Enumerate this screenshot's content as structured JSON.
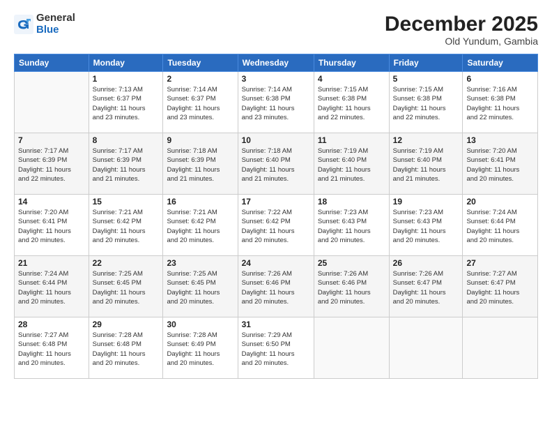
{
  "logo": {
    "general": "General",
    "blue": "Blue"
  },
  "title": "December 2025",
  "subtitle": "Old Yundum, Gambia",
  "days_header": [
    "Sunday",
    "Monday",
    "Tuesday",
    "Wednesday",
    "Thursday",
    "Friday",
    "Saturday"
  ],
  "weeks": [
    [
      {
        "day": "",
        "info": ""
      },
      {
        "day": "1",
        "info": "Sunrise: 7:13 AM\nSunset: 6:37 PM\nDaylight: 11 hours\nand 23 minutes."
      },
      {
        "day": "2",
        "info": "Sunrise: 7:14 AM\nSunset: 6:37 PM\nDaylight: 11 hours\nand 23 minutes."
      },
      {
        "day": "3",
        "info": "Sunrise: 7:14 AM\nSunset: 6:38 PM\nDaylight: 11 hours\nand 23 minutes."
      },
      {
        "day": "4",
        "info": "Sunrise: 7:15 AM\nSunset: 6:38 PM\nDaylight: 11 hours\nand 22 minutes."
      },
      {
        "day": "5",
        "info": "Sunrise: 7:15 AM\nSunset: 6:38 PM\nDaylight: 11 hours\nand 22 minutes."
      },
      {
        "day": "6",
        "info": "Sunrise: 7:16 AM\nSunset: 6:38 PM\nDaylight: 11 hours\nand 22 minutes."
      }
    ],
    [
      {
        "day": "7",
        "info": "Sunrise: 7:17 AM\nSunset: 6:39 PM\nDaylight: 11 hours\nand 22 minutes."
      },
      {
        "day": "8",
        "info": "Sunrise: 7:17 AM\nSunset: 6:39 PM\nDaylight: 11 hours\nand 21 minutes."
      },
      {
        "day": "9",
        "info": "Sunrise: 7:18 AM\nSunset: 6:39 PM\nDaylight: 11 hours\nand 21 minutes."
      },
      {
        "day": "10",
        "info": "Sunrise: 7:18 AM\nSunset: 6:40 PM\nDaylight: 11 hours\nand 21 minutes."
      },
      {
        "day": "11",
        "info": "Sunrise: 7:19 AM\nSunset: 6:40 PM\nDaylight: 11 hours\nand 21 minutes."
      },
      {
        "day": "12",
        "info": "Sunrise: 7:19 AM\nSunset: 6:40 PM\nDaylight: 11 hours\nand 21 minutes."
      },
      {
        "day": "13",
        "info": "Sunrise: 7:20 AM\nSunset: 6:41 PM\nDaylight: 11 hours\nand 20 minutes."
      }
    ],
    [
      {
        "day": "14",
        "info": "Sunrise: 7:20 AM\nSunset: 6:41 PM\nDaylight: 11 hours\nand 20 minutes."
      },
      {
        "day": "15",
        "info": "Sunrise: 7:21 AM\nSunset: 6:42 PM\nDaylight: 11 hours\nand 20 minutes."
      },
      {
        "day": "16",
        "info": "Sunrise: 7:21 AM\nSunset: 6:42 PM\nDaylight: 11 hours\nand 20 minutes."
      },
      {
        "day": "17",
        "info": "Sunrise: 7:22 AM\nSunset: 6:42 PM\nDaylight: 11 hours\nand 20 minutes."
      },
      {
        "day": "18",
        "info": "Sunrise: 7:23 AM\nSunset: 6:43 PM\nDaylight: 11 hours\nand 20 minutes."
      },
      {
        "day": "19",
        "info": "Sunrise: 7:23 AM\nSunset: 6:43 PM\nDaylight: 11 hours\nand 20 minutes."
      },
      {
        "day": "20",
        "info": "Sunrise: 7:24 AM\nSunset: 6:44 PM\nDaylight: 11 hours\nand 20 minutes."
      }
    ],
    [
      {
        "day": "21",
        "info": "Sunrise: 7:24 AM\nSunset: 6:44 PM\nDaylight: 11 hours\nand 20 minutes."
      },
      {
        "day": "22",
        "info": "Sunrise: 7:25 AM\nSunset: 6:45 PM\nDaylight: 11 hours\nand 20 minutes."
      },
      {
        "day": "23",
        "info": "Sunrise: 7:25 AM\nSunset: 6:45 PM\nDaylight: 11 hours\nand 20 minutes."
      },
      {
        "day": "24",
        "info": "Sunrise: 7:26 AM\nSunset: 6:46 PM\nDaylight: 11 hours\nand 20 minutes."
      },
      {
        "day": "25",
        "info": "Sunrise: 7:26 AM\nSunset: 6:46 PM\nDaylight: 11 hours\nand 20 minutes."
      },
      {
        "day": "26",
        "info": "Sunrise: 7:26 AM\nSunset: 6:47 PM\nDaylight: 11 hours\nand 20 minutes."
      },
      {
        "day": "27",
        "info": "Sunrise: 7:27 AM\nSunset: 6:47 PM\nDaylight: 11 hours\nand 20 minutes."
      }
    ],
    [
      {
        "day": "28",
        "info": "Sunrise: 7:27 AM\nSunset: 6:48 PM\nDaylight: 11 hours\nand 20 minutes."
      },
      {
        "day": "29",
        "info": "Sunrise: 7:28 AM\nSunset: 6:48 PM\nDaylight: 11 hours\nand 20 minutes."
      },
      {
        "day": "30",
        "info": "Sunrise: 7:28 AM\nSunset: 6:49 PM\nDaylight: 11 hours\nand 20 minutes."
      },
      {
        "day": "31",
        "info": "Sunrise: 7:29 AM\nSunset: 6:50 PM\nDaylight: 11 hours\nand 20 minutes."
      },
      {
        "day": "",
        "info": ""
      },
      {
        "day": "",
        "info": ""
      },
      {
        "day": "",
        "info": ""
      }
    ]
  ]
}
